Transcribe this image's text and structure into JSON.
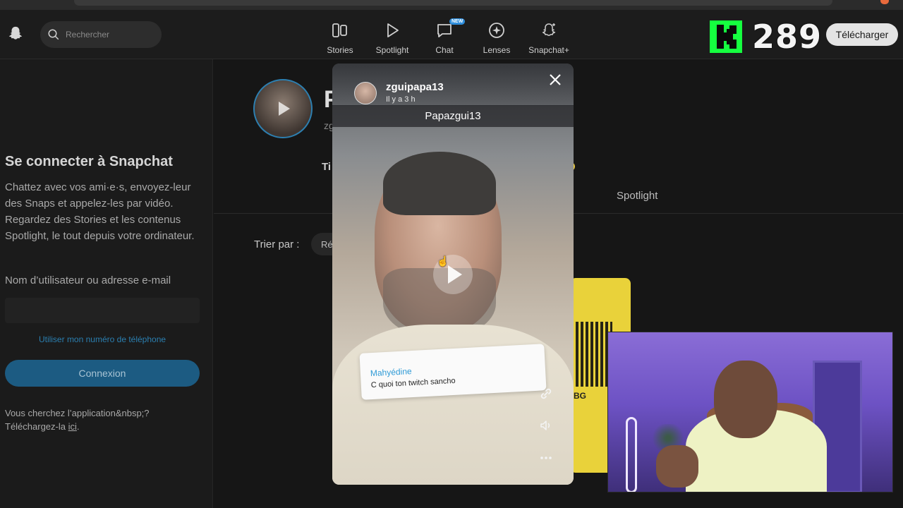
{
  "topbar": {
    "search_placeholder": "Rechercher",
    "nav": [
      {
        "label": "Stories",
        "icon": "stories-icon"
      },
      {
        "label": "Spotlight",
        "icon": "play-icon"
      },
      {
        "label": "Chat",
        "icon": "chat-icon",
        "badge": "NEW"
      },
      {
        "label": "Lenses",
        "icon": "lenses-icon"
      },
      {
        "label": "Snapchat+",
        "icon": "snapchat-plus-icon"
      }
    ],
    "download_label": "Télécharger"
  },
  "overlay": {
    "kick_count": "289",
    "kick_color": "#15ff3f"
  },
  "left_panel": {
    "title": "Se connecter à Snapchat",
    "description": "Chattez avec vos ami·e·s, envoyez-leur des Snaps et appelez-les par vidéo. Regardez des Stories et les contenus Spotlight, le tout depuis votre ordinateur.",
    "username_label": "Nom d’utilisateur ou adresse e-mail",
    "phone_link": "Utiliser mon numéro de téléphone",
    "login_button": "Connexion",
    "footer_line1": "Vous cherchez l’application&nbsp;?",
    "footer_prefix": "Téléchargez-la ",
    "footer_link": "ici",
    "footer_suffix": "."
  },
  "profile": {
    "title_partial": "P",
    "sub_partial": "zg",
    "tab_partial": "Ti",
    "tab_spotlight": "Spotlight",
    "sort_label": "Trier par :",
    "sort_value": "Ré",
    "snapcode_text": "BG"
  },
  "story": {
    "username": "zguipapa13",
    "time": "Il y a 3 h",
    "caption": "Papazgui13",
    "reply_name": "Mahyédine",
    "reply_text": "C quoi  ton twitch sancho"
  }
}
